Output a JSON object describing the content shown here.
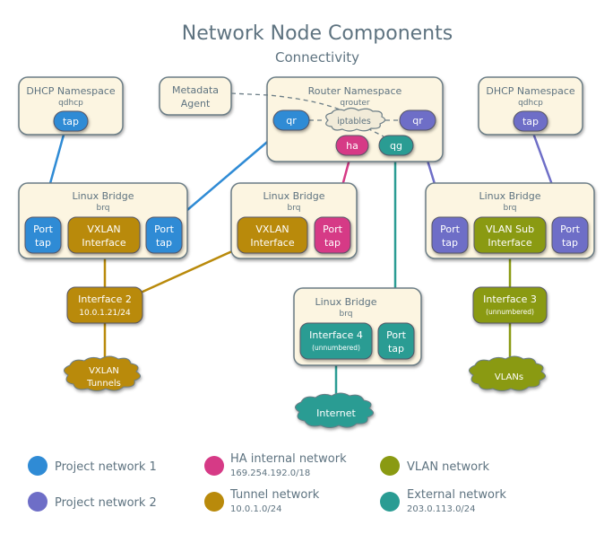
{
  "title": "Network Node Components",
  "subtitle": "Connectivity",
  "colors": {
    "project1": "#2f8bd5",
    "project2": "#6e6ec7",
    "ha": "#d63a86",
    "tunnel": "#b98a0b",
    "vlan": "#8a9a12",
    "external": "#2a9c93",
    "box_fill": "#fcf5e1",
    "text": "#5e7380"
  },
  "dhcp_left": {
    "title": "DHCP Namespace",
    "sub": "qdhcp",
    "port": "tap"
  },
  "dhcp_right": {
    "title": "DHCP Namespace",
    "sub": "qdhcp",
    "port": "tap"
  },
  "metadata": {
    "line1": "Metadata",
    "line2": "Agent"
  },
  "router": {
    "title": "Router Namespace",
    "sub": "qrouter",
    "qr_left": "qr",
    "qr_right": "qr",
    "iptables": "iptables",
    "ha": "ha",
    "qg": "qg"
  },
  "bridge1": {
    "title": "Linux Bridge",
    "sub": "brq",
    "port_left": {
      "line1": "Port",
      "line2": "tap"
    },
    "vxlan": {
      "line1": "VXLAN",
      "line2": "Interface"
    },
    "port_right": {
      "line1": "Port",
      "line2": "tap"
    }
  },
  "bridge2": {
    "title": "Linux Bridge",
    "sub": "brq",
    "vxlan": {
      "line1": "VXLAN",
      "line2": "Interface"
    },
    "port": {
      "line1": "Port",
      "line2": "tap"
    }
  },
  "bridge3": {
    "title": "Linux Bridge",
    "sub": "brq",
    "port_left": {
      "line1": "Port",
      "line2": "tap"
    },
    "vlan_sub": {
      "line1": "VLAN Sub",
      "line2": "Interface"
    },
    "port_right": {
      "line1": "Port",
      "line2": "tap"
    }
  },
  "bridge4": {
    "title": "Linux Bridge",
    "sub": "brq",
    "iface": {
      "line1": "Interface 4",
      "line2": "(unnumbered)"
    },
    "port": {
      "line1": "Port",
      "line2": "tap"
    }
  },
  "interface2": {
    "line1": "Interface 2",
    "line2": "10.0.1.21/24"
  },
  "interface3": {
    "line1": "Interface 3",
    "line2": "(unnumbered)"
  },
  "clouds": {
    "vxlan": {
      "line1": "VXLAN",
      "line2": "Tunnels"
    },
    "internet": "Internet",
    "vlans": "VLANs"
  },
  "legend": [
    {
      "label": "Project network 1",
      "sub": "",
      "color": "#2f8bd5"
    },
    {
      "label": "Project network 2",
      "sub": "",
      "color": "#6e6ec7"
    },
    {
      "label": "HA internal network",
      "sub": "169.254.192.0/18",
      "color": "#d63a86"
    },
    {
      "label": "Tunnel network",
      "sub": "10.0.1.0/24",
      "color": "#b98a0b"
    },
    {
      "label": "VLAN network",
      "sub": "",
      "color": "#8a9a12"
    },
    {
      "label": "External network",
      "sub": "203.0.113.0/24",
      "color": "#2a9c93"
    }
  ]
}
